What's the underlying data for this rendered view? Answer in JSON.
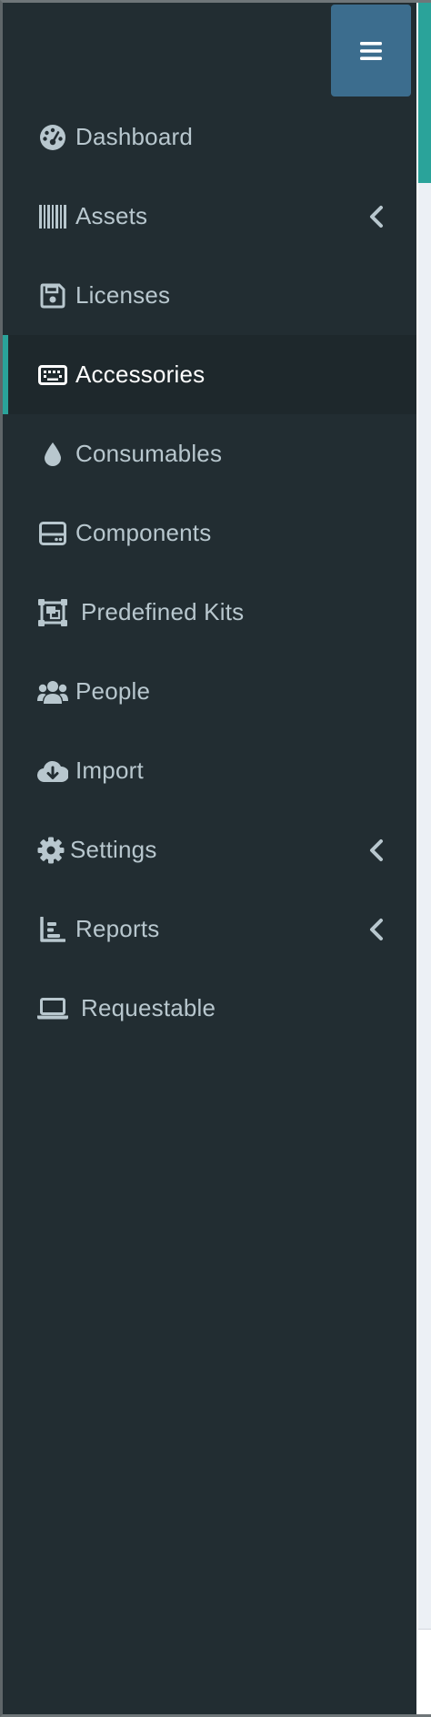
{
  "sidebar": {
    "toggle_icon": "hamburger-icon",
    "items": [
      {
        "label": "Dashboard",
        "icon": "tachometer-icon",
        "has_submenu": false,
        "active": false
      },
      {
        "label": "Assets",
        "icon": "barcode-icon",
        "has_submenu": true,
        "active": false
      },
      {
        "label": "Licenses",
        "icon": "floppy-disk-icon",
        "has_submenu": false,
        "active": false
      },
      {
        "label": "Accessories",
        "icon": "keyboard-icon",
        "has_submenu": false,
        "active": true
      },
      {
        "label": "Consumables",
        "icon": "droplet-icon",
        "has_submenu": false,
        "active": false
      },
      {
        "label": "Components",
        "icon": "hard-drive-icon",
        "has_submenu": false,
        "active": false
      },
      {
        "label": "Predefined Kits",
        "icon": "object-group-icon",
        "has_submenu": false,
        "active": false
      },
      {
        "label": "People",
        "icon": "users-icon",
        "has_submenu": false,
        "active": false
      },
      {
        "label": "Import",
        "icon": "cloud-download-icon",
        "has_submenu": false,
        "active": false
      },
      {
        "label": "Settings",
        "icon": "cog-icon",
        "has_submenu": true,
        "active": false
      },
      {
        "label": "Reports",
        "icon": "bar-chart-icon",
        "has_submenu": true,
        "active": false
      },
      {
        "label": "Requestable",
        "icon": "laptop-icon",
        "has_submenu": false,
        "active": false
      }
    ]
  },
  "colors": {
    "sidebar_bg": "#222d32",
    "active_bg": "#1e282c",
    "accent": "#2aa39a",
    "toggle_bg": "#3c6d8e",
    "text": "#b8c7ce",
    "active_text": "#ffffff"
  }
}
